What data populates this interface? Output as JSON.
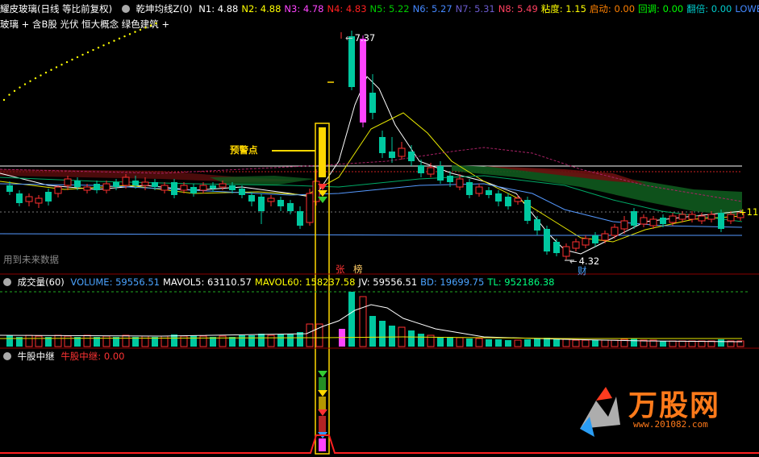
{
  "header": {
    "title": "耀皮玻璃(日线 等比前复权)",
    "indicator_name": "乾坤均线Z(0)",
    "values": [
      {
        "label": "N1: 4.88",
        "color": "#ffffff"
      },
      {
        "label": "N2: 4.88",
        "color": "#ffff00"
      },
      {
        "label": "N3: 4.78",
        "color": "#ff44ff"
      },
      {
        "label": "N4: 4.83",
        "color": "#ff2020"
      },
      {
        "label": "N5: 5.22",
        "color": "#00cc00"
      },
      {
        "label": "N6: 5.27",
        "color": "#4488ff"
      },
      {
        "label": "N7: 5.31",
        "color": "#6a5acd"
      },
      {
        "label": "N8: 5.49",
        "color": "#ff4060"
      },
      {
        "label": "粘度: 1.15",
        "color": "#ffff00"
      },
      {
        "label": "启动: 0.00",
        "color": "#ff8000"
      },
      {
        "label": "回调: 0.00",
        "color": "#00ff00"
      },
      {
        "label": "翻倍: 0.00",
        "color": "#00cccc"
      },
      {
        "label": "LOWE",
        "color": "#4488ff"
      }
    ]
  },
  "concepts": "玻璃 + 含B股 光伏 恒大概念 绿色建筑 +",
  "main_chart": {
    "annotation_warning": "预警点",
    "high_price": "7.37",
    "low_price": "4.32",
    "right_price": "11.",
    "future_data_note": "用到未来数据",
    "tag_zhang": "张",
    "tag_bang": "榜",
    "tag_cai": "财"
  },
  "volume_panel": {
    "title": "成交量(60)",
    "values": [
      {
        "label": "VOLUME: 59556.51",
        "color": "#4aa3ff"
      },
      {
        "label": "MAVOL5: 63110.57",
        "color": "#ffffff"
      },
      {
        "label": "MAVOL60: 158237.58",
        "color": "#ffff00"
      },
      {
        "label": "JV: 59556.51",
        "color": "#ffffff"
      },
      {
        "label": "BD: 19699.75",
        "color": "#4aa3ff"
      },
      {
        "label": "TL: 952186.38",
        "color": "#00ff7f"
      }
    ]
  },
  "signal_panel": {
    "title": "牛股中继",
    "value_label": "牛股中继: 0.00"
  },
  "watermark": {
    "brand": "万股网",
    "url": "www.201082.com"
  },
  "colors": {
    "up": "#ff3030",
    "down": "#00c8a0",
    "highlight": "#ff44ff",
    "warning": "#ffd700"
  }
}
